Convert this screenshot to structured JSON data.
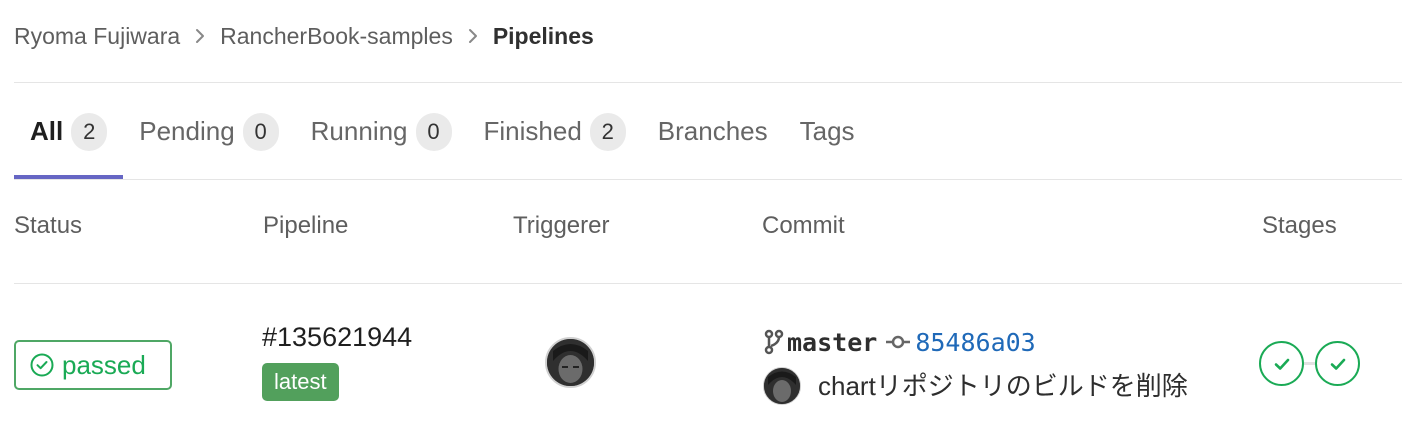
{
  "breadcrumb": {
    "items": [
      "Ryoma Fujiwara",
      "RancherBook-samples"
    ],
    "current": "Pipelines"
  },
  "tabs": [
    {
      "label": "All",
      "count": "2",
      "active": true
    },
    {
      "label": "Pending",
      "count": "0"
    },
    {
      "label": "Running",
      "count": "0"
    },
    {
      "label": "Finished",
      "count": "2"
    },
    {
      "label": "Branches"
    },
    {
      "label": "Tags"
    }
  ],
  "table": {
    "headers": {
      "status": "Status",
      "pipeline": "Pipeline",
      "triggerer": "Triggerer",
      "commit": "Commit",
      "stages": "Stages"
    }
  },
  "row": {
    "status": "passed",
    "pipeline_id": "#135621944",
    "latest_label": "latest",
    "branch": "master",
    "sha": "85486a03",
    "commit_title": "chartリポジトリのビルドを削除",
    "stages": [
      "passed",
      "passed"
    ]
  },
  "colors": {
    "success": "#1aaa55",
    "active_tab_underline": "#6666c4",
    "link": "#1f69b8",
    "latest_bg": "#52a05c"
  },
  "icons": {
    "breadcrumb_separator": "chevron-right-icon",
    "status": "check-circle-icon",
    "branch": "branch-icon",
    "commit": "commit-icon",
    "stage": "check-icon"
  }
}
